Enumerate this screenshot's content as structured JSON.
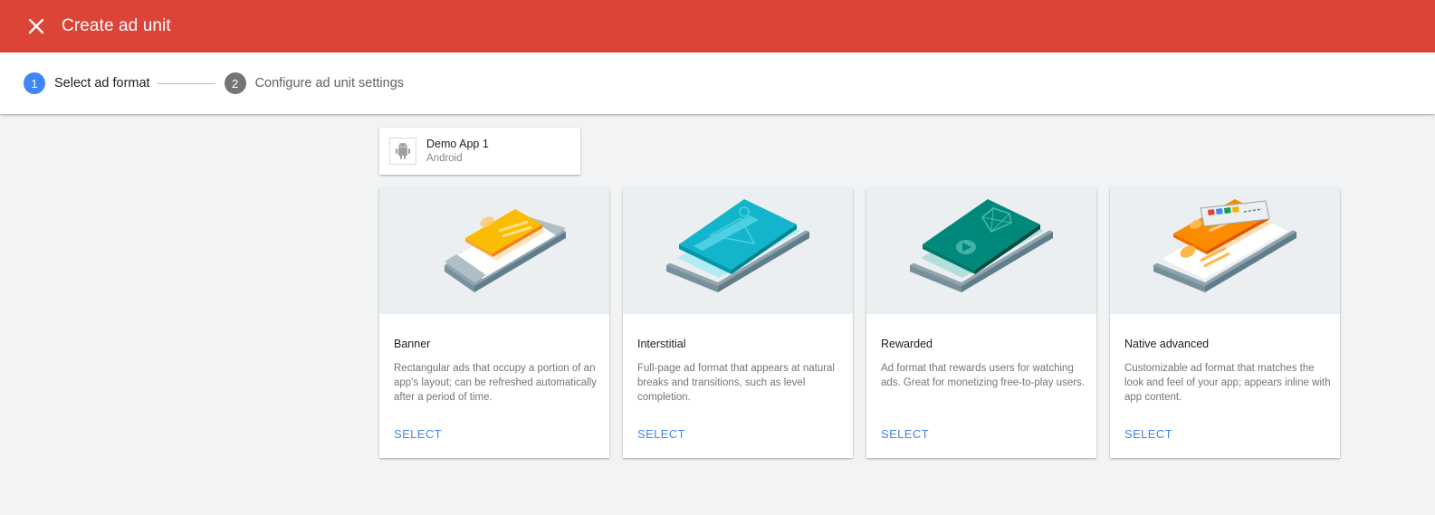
{
  "header": {
    "title": "Create ad unit",
    "close_icon": "close-icon",
    "color": "#db4437"
  },
  "stepper": {
    "steps": [
      {
        "number": "1",
        "label": "Select ad format",
        "state": "active"
      },
      {
        "number": "2",
        "label": "Configure ad unit settings",
        "state": "inactive"
      }
    ]
  },
  "app": {
    "name": "Demo App 1",
    "platform": "Android",
    "icon": "android-icon"
  },
  "formats": [
    {
      "title": "Banner",
      "description": "Rectangular ads that occupy a portion of an app's layout; can be refreshed automatically after a period of time.",
      "action": "SELECT",
      "accent": "#fbbc04"
    },
    {
      "title": "Interstitial",
      "description": "Full-page ad format that appears at natural breaks and transitions, such as level completion.",
      "action": "SELECT",
      "accent": "#12b5cb"
    },
    {
      "title": "Rewarded",
      "description": "Ad format that rewards users for watching ads. Great for monetizing free-to-play users.",
      "action": "SELECT",
      "accent": "#00897b"
    },
    {
      "title": "Native advanced",
      "description": "Customizable ad format that matches the look and feel of your app; appears inline with app content.",
      "action": "SELECT",
      "accent": "#fb8c00"
    }
  ]
}
